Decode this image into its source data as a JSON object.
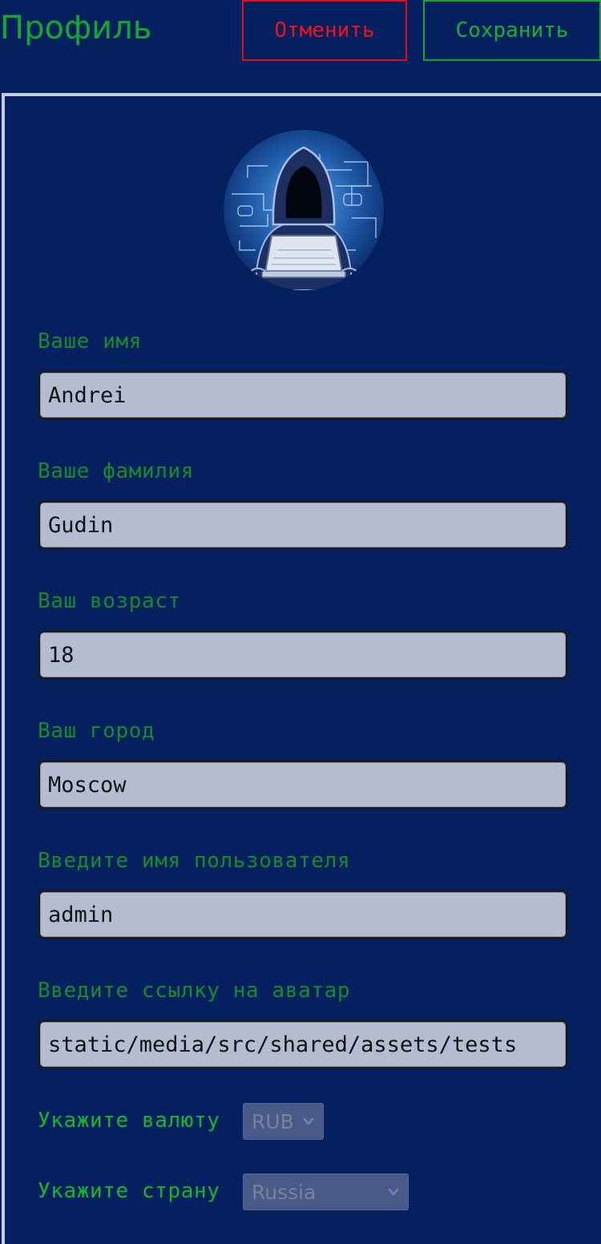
{
  "header": {
    "title": "Профиль",
    "cancel_label": "Отменить",
    "save_label": "Сохранить"
  },
  "colors": {
    "background": "#05205e",
    "accent_green": "#19b034",
    "cancel_red": "#f0101e",
    "input_bg": "#b4bdd0"
  },
  "profile": {
    "avatar_icon": "hacker-avatar",
    "fields": [
      {
        "label": "Ваше имя",
        "value": "Andrei"
      },
      {
        "label": "Ваше фамилия",
        "value": "Gudin"
      },
      {
        "label": "Ваш возраст",
        "value": "18"
      },
      {
        "label": "Ваш город",
        "value": "Moscow"
      },
      {
        "label": "Введите имя пользователя",
        "value": "admin"
      },
      {
        "label": "Введите ссылку на аватар",
        "value": "static/media/src/shared/assets/tests"
      }
    ],
    "currency": {
      "label": "Укажите валюту",
      "selected": "RUB"
    },
    "country": {
      "label": "Укажите страну",
      "selected": "Russia"
    }
  }
}
